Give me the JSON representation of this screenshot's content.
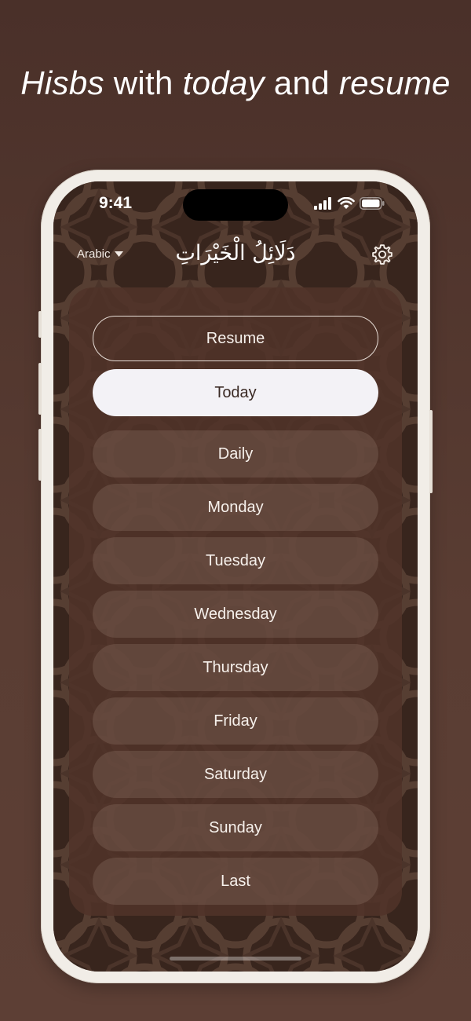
{
  "headline": {
    "part1": "Hisbs",
    "part2": " with ",
    "part3": "today",
    "part4": " and ",
    "part5": "resume"
  },
  "status_bar": {
    "time": "9:41"
  },
  "header": {
    "language": "Arabic",
    "title": "دَلَائِلُ الْخَيْرَاتِ"
  },
  "buttons": {
    "resume": "Resume",
    "today": "Today"
  },
  "days": [
    "Daily",
    "Monday",
    "Tuesday",
    "Wednesday",
    "Thursday",
    "Friday",
    "Saturday",
    "Sunday",
    "Last"
  ],
  "colors": {
    "background": "#5a3d33",
    "phone_frame": "#f1ede7",
    "screen_bg": "#3d2820",
    "today_button_bg": "#f3f2f6"
  },
  "icons": {
    "language_dropdown": "caret-down-icon",
    "settings": "gear-icon",
    "signal": "signal-icon",
    "wifi": "wifi-icon",
    "battery": "battery-icon"
  }
}
